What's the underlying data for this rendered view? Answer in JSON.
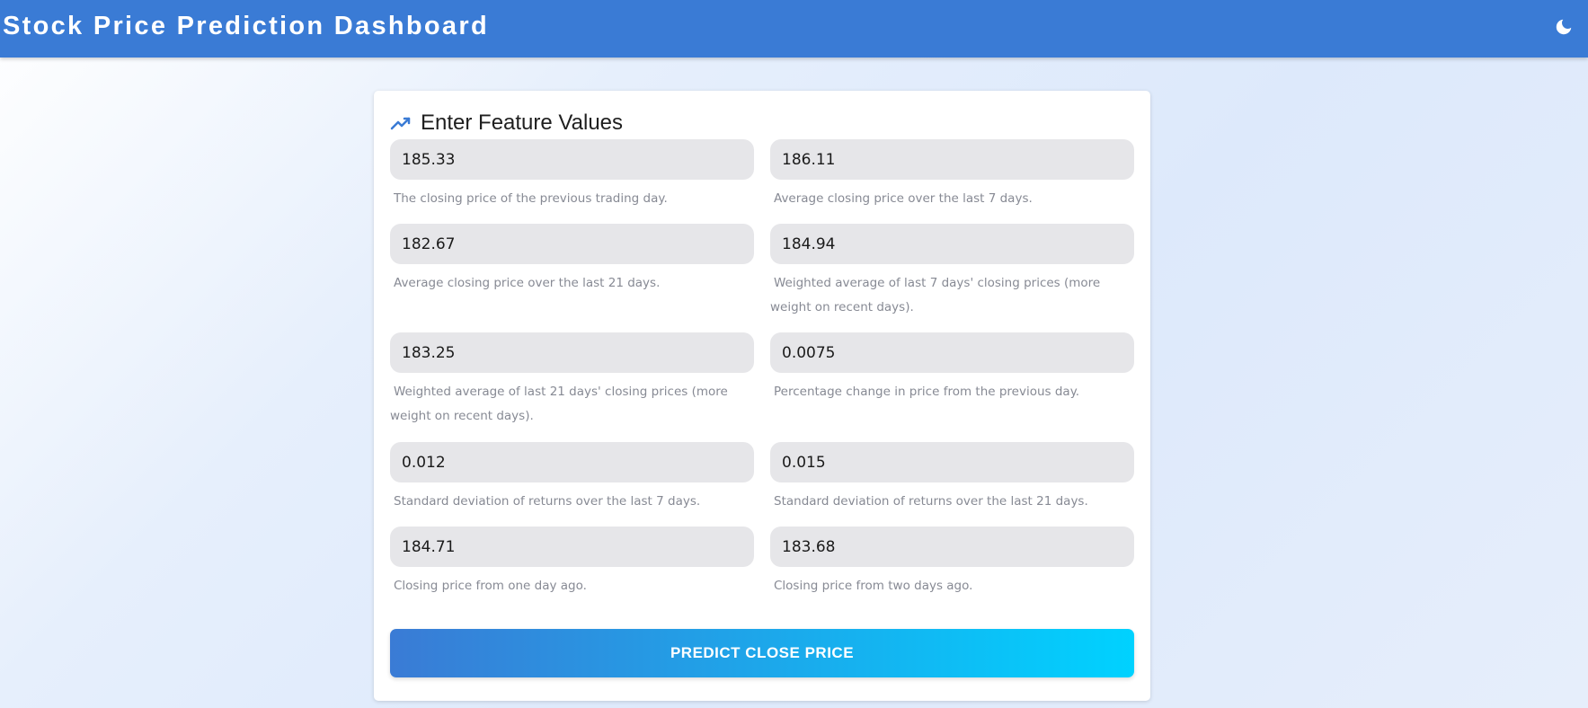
{
  "header": {
    "title": "Stock Price Prediction Dashboard",
    "theme_toggle_icon": "moon-icon"
  },
  "card": {
    "icon": "trend-line-icon",
    "title": "Enter Feature Values"
  },
  "fields": [
    {
      "value": "185.33",
      "help": "The closing price of the previous trading day."
    },
    {
      "value": "186.11",
      "help": "Average closing price over the last 7 days."
    },
    {
      "value": "182.67",
      "help": "Average closing price over the last 21 days."
    },
    {
      "value": "184.94",
      "help": "Weighted average of last 7 days' closing prices (more weight on recent days)."
    },
    {
      "value": "183.25",
      "help": "Weighted average of last 21 days' closing prices (more weight on recent days)."
    },
    {
      "value": "0.0075",
      "help": "Percentage change in price from the previous day."
    },
    {
      "value": "0.012",
      "help": "Standard deviation of returns over the last 7 days."
    },
    {
      "value": "0.015",
      "help": "Standard deviation of returns over the last 21 days."
    },
    {
      "value": "184.71",
      "help": "Closing price from one day ago."
    },
    {
      "value": "183.68",
      "help": "Closing price from two days ago."
    }
  ],
  "predict_button_label": "PREDICT CLOSE PRICE",
  "colors": {
    "header": "#3a7bd5",
    "button_start": "#3a7bd5",
    "button_end": "#00d2ff",
    "input_bg": "#e6e6e9",
    "help_text": "#878a94"
  }
}
